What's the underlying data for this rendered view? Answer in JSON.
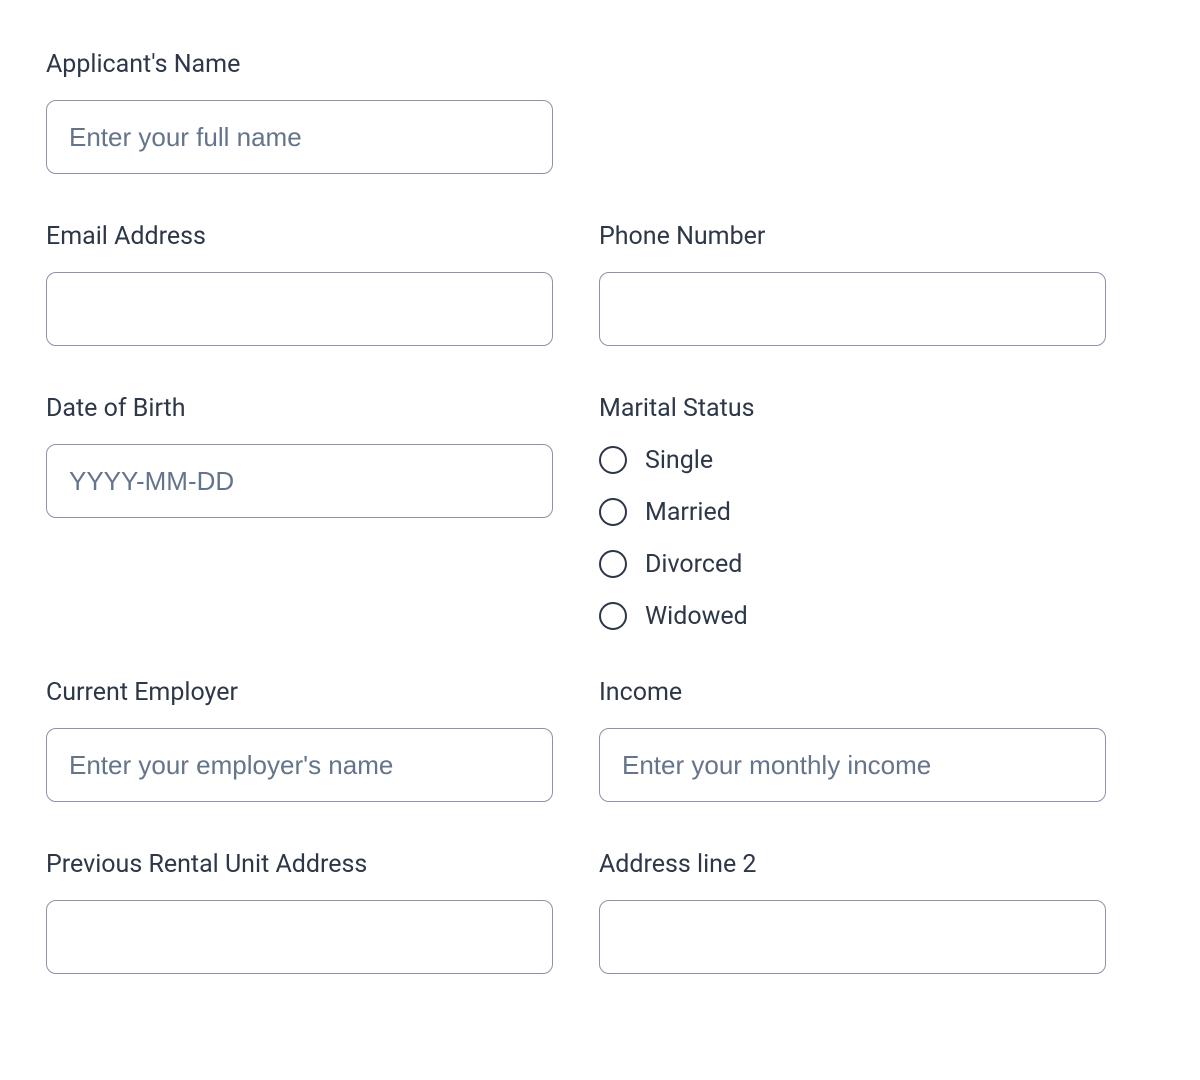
{
  "fields": {
    "applicantName": {
      "label": "Applicant's Name",
      "placeholder": "Enter your full name",
      "value": ""
    },
    "email": {
      "label": "Email Address",
      "placeholder": "",
      "value": ""
    },
    "phone": {
      "label": "Phone Number",
      "placeholder": "",
      "value": ""
    },
    "dob": {
      "label": "Date of Birth",
      "placeholder": "YYYY-MM-DD",
      "value": ""
    },
    "maritalStatus": {
      "label": "Marital Status",
      "options": [
        "Single",
        "Married",
        "Divorced",
        "Widowed"
      ],
      "selected": null
    },
    "employer": {
      "label": "Current Employer",
      "placeholder": "Enter your employer's name",
      "value": ""
    },
    "income": {
      "label": "Income",
      "placeholder": "Enter your monthly income",
      "value": ""
    },
    "prevAddress": {
      "label": "Previous Rental Unit Address",
      "placeholder": "",
      "value": ""
    },
    "address2": {
      "label": "Address line 2",
      "placeholder": "",
      "value": ""
    }
  }
}
